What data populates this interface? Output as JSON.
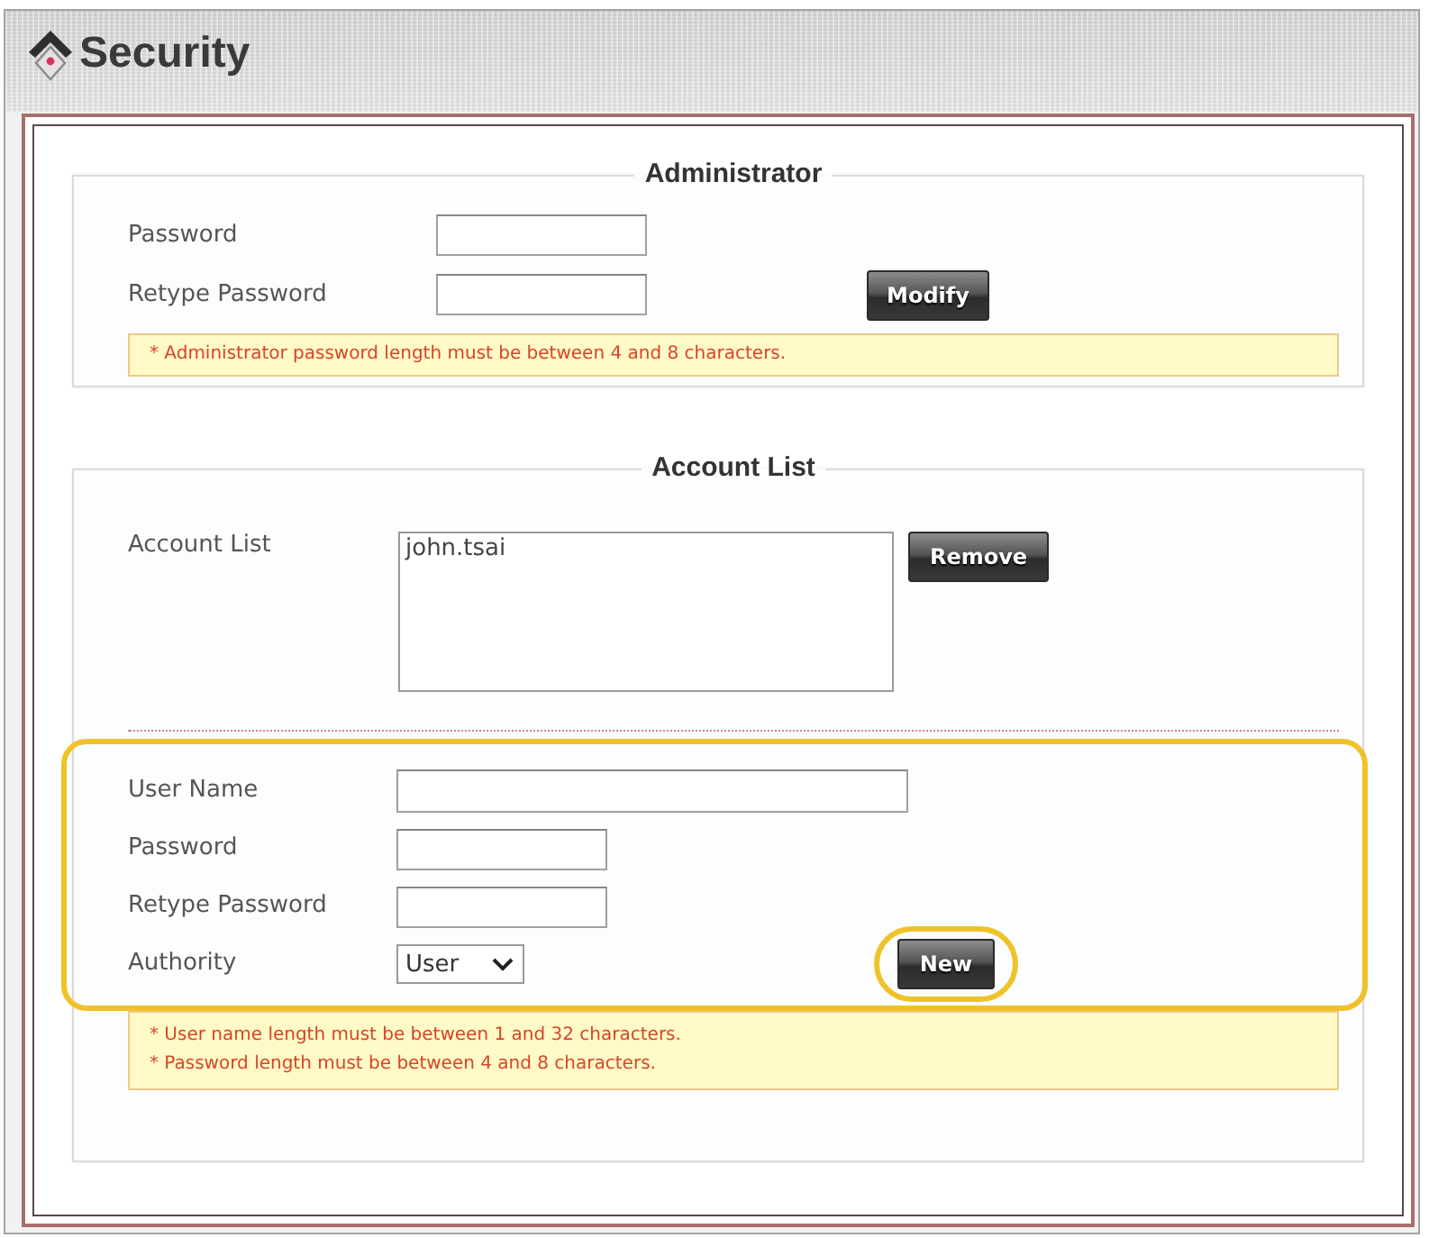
{
  "window": {
    "title": "Security"
  },
  "administrator": {
    "legend": "Administrator",
    "fields": [
      {
        "label": "Password"
      },
      {
        "label": "Retype Password"
      }
    ],
    "button": "Modify",
    "note": "* Administrator password length must be between 4 and 8 characters."
  },
  "account_list": {
    "legend": "Account List",
    "list_label": "Account List",
    "accounts": [
      {
        "name": "john.tsai",
        "selected": false
      }
    ],
    "button": "Remove",
    "new_account": {
      "highlighted": true,
      "fields": [
        {
          "kind": "text",
          "label": "User Name"
        },
        {
          "kind": "password",
          "label": "Password"
        },
        {
          "kind": "password",
          "label": "Retype Password"
        },
        {
          "kind": "select",
          "label": "Authority",
          "value": "User"
        }
      ],
      "button": {
        "label": "New",
        "highlighted": true
      }
    },
    "notes": [
      "* User name length must be between 1 and 32 characters.",
      "* Password length must be between 4 and 8 characters."
    ]
  }
}
